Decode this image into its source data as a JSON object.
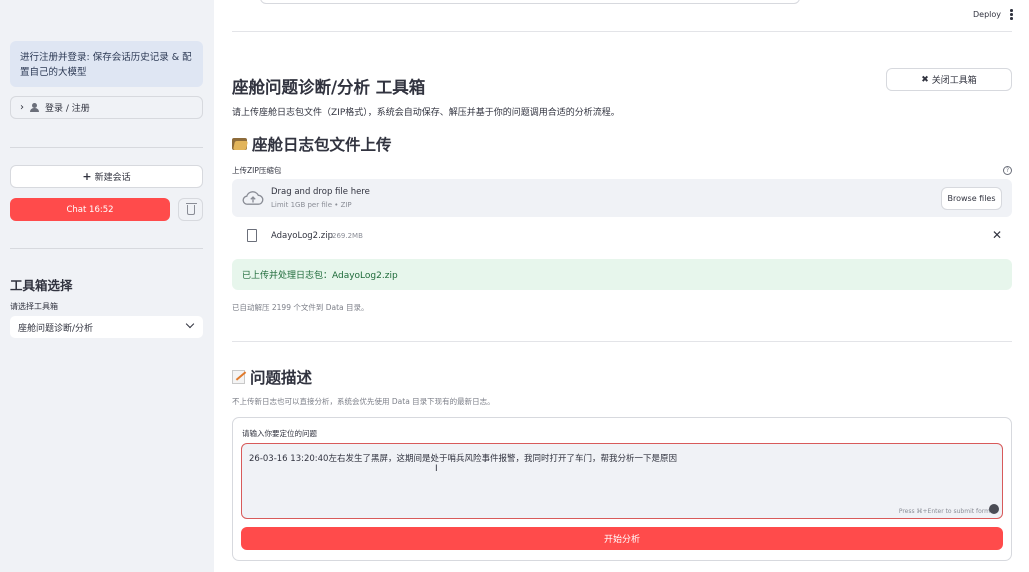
{
  "sidebar": {
    "info_text": "进行注册并登录: 保存会话历史记录 & 配置自己的大模型",
    "login_label": "登录 / 注册",
    "new_chat_label": "新建会话",
    "chat_item_label": "Chat 16:52",
    "toolbox_heading": "工具箱选择",
    "toolbox_select_label": "请选择工具箱",
    "toolbox_selected": "座舱问题诊断/分析"
  },
  "header": {
    "deploy_label": "Deploy"
  },
  "main": {
    "title": "座舱问题诊断/分析 工具箱",
    "close_button_label": "关闭工具箱",
    "description": "请上传座舱日志包文件（ZIP格式），系统会自动保存、解压并基于你的问题调用合适的分析流程。",
    "upload_section": {
      "heading": "座舱日志包文件上传",
      "uploader_label": "上传ZIP压缩包",
      "drop_text": "Drag and drop file here",
      "limit_text": "Limit 1GB per file • ZIP",
      "browse_label": "Browse files",
      "file_name": "AdayoLog2.zip",
      "file_size": "269.2MB",
      "success_message": "已上传并处理日志包：AdayoLog2.zip",
      "extract_caption": "已自动解压 2199 个文件到 Data 目录。"
    },
    "question_section": {
      "heading": "问题描述",
      "caption": "不上传新日志也可以直接分析，系统会优先使用 Data 目录下现有的最新日志。",
      "input_label": "请输入你要定位的问题",
      "input_value": "26-03-16 13:20:40左右发生了黑屏，这期间是处于哨兵风险事件报警，我同时打开了车门，帮我分析一下是原因",
      "submit_hint": "Press ⌘+Enter to submit form",
      "submit_label": "开始分析"
    }
  },
  "colors": {
    "primary": "#ff4b4b",
    "sidebar_bg": "#f0f2f6",
    "info_bg": "#dfe6f3",
    "success_bg": "#e7f6ec"
  }
}
